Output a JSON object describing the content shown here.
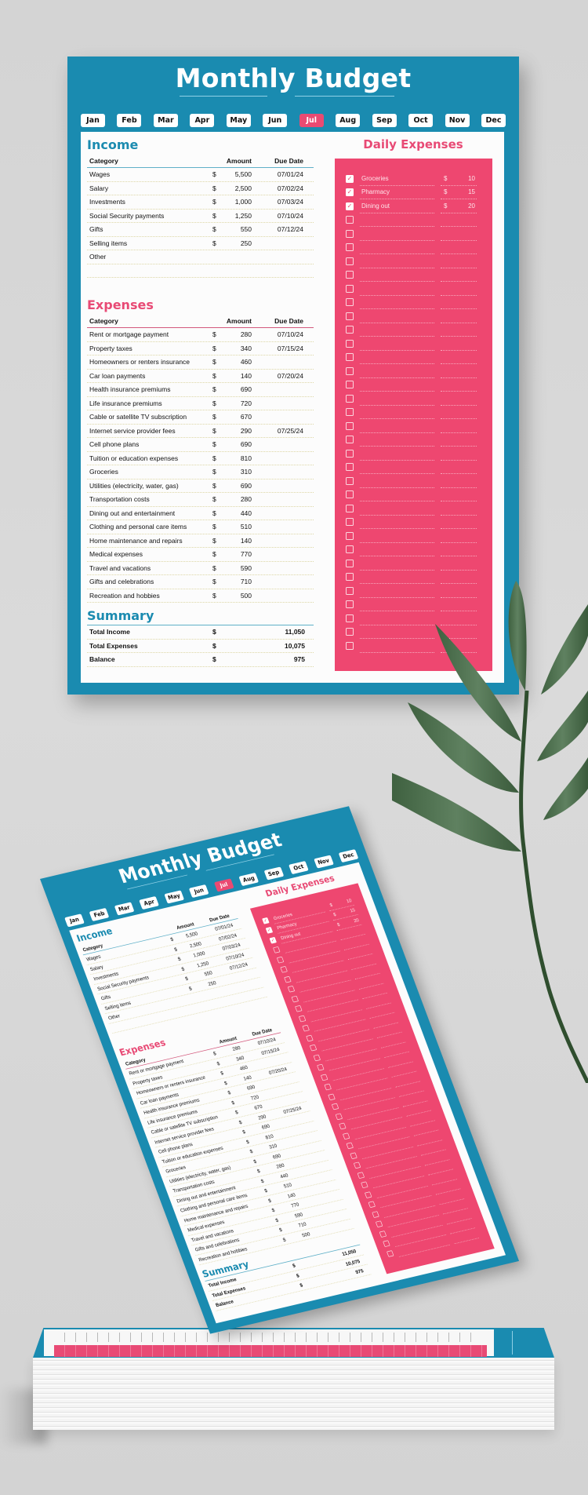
{
  "title": "Monthly Budget",
  "months": [
    {
      "label": "Jan",
      "active": false
    },
    {
      "label": "Feb",
      "active": false
    },
    {
      "label": "Mar",
      "active": false
    },
    {
      "label": "Apr",
      "active": false
    },
    {
      "label": "May",
      "active": false
    },
    {
      "label": "Jun",
      "active": false
    },
    {
      "label": "Jul",
      "active": true
    },
    {
      "label": "Aug",
      "active": false
    },
    {
      "label": "Sep",
      "active": false
    },
    {
      "label": "Oct",
      "active": false
    },
    {
      "label": "Nov",
      "active": false
    },
    {
      "label": "Dec",
      "active": false
    }
  ],
  "colors": {
    "frame": "#1a8bb0",
    "accent_pink": "#ee4770",
    "income_blue": "#1b8bb0",
    "expenses_pink": "#e84a75",
    "background": "#d6d6d6"
  },
  "income": {
    "title": "Income",
    "headers": {
      "category": "Category",
      "amount": "Amount",
      "due_date": "Due Date"
    },
    "rows": [
      {
        "category": "Wages",
        "currency": "$",
        "amount": "5,500",
        "due_date": "07/01/24"
      },
      {
        "category": "Salary",
        "currency": "$",
        "amount": "2,500",
        "due_date": "07/02/24"
      },
      {
        "category": "Investments",
        "currency": "$",
        "amount": "1,000",
        "due_date": "07/03/24"
      },
      {
        "category": "Social Security payments",
        "currency": "$",
        "amount": "1,250",
        "due_date": "07/10/24"
      },
      {
        "category": "Gifts",
        "currency": "$",
        "amount": "550",
        "due_date": "07/12/24"
      },
      {
        "category": "Selling items",
        "currency": "$",
        "amount": "250",
        "due_date": ""
      },
      {
        "category": "Other",
        "currency": "",
        "amount": "",
        "due_date": ""
      },
      {
        "category": "",
        "currency": "",
        "amount": "",
        "due_date": ""
      }
    ]
  },
  "expenses": {
    "title": "Expenses",
    "headers": {
      "category": "Category",
      "amount": "Amount",
      "due_date": "Due Date"
    },
    "rows": [
      {
        "category": "Rent or mortgage payment",
        "currency": "$",
        "amount": "280",
        "due_date": "07/10/24"
      },
      {
        "category": "Property taxes",
        "currency": "$",
        "amount": "340",
        "due_date": "07/15/24"
      },
      {
        "category": "Homeowners or renters insurance",
        "currency": "$",
        "amount": "460",
        "due_date": ""
      },
      {
        "category": "Car loan payments",
        "currency": "$",
        "amount": "140",
        "due_date": "07/20/24"
      },
      {
        "category": "Health insurance premiums",
        "currency": "$",
        "amount": "690",
        "due_date": ""
      },
      {
        "category": "Life insurance premiums",
        "currency": "$",
        "amount": "720",
        "due_date": ""
      },
      {
        "category": "Cable or satellite TV subscription",
        "currency": "$",
        "amount": "670",
        "due_date": ""
      },
      {
        "category": "Internet service provider fees",
        "currency": "$",
        "amount": "290",
        "due_date": "07/25/24"
      },
      {
        "category": "Cell phone plans",
        "currency": "$",
        "amount": "690",
        "due_date": ""
      },
      {
        "category": "Tuition or education expenses",
        "currency": "$",
        "amount": "810",
        "due_date": ""
      },
      {
        "category": "Groceries",
        "currency": "$",
        "amount": "310",
        "due_date": ""
      },
      {
        "category": "Utilities (electricity, water, gas)",
        "currency": "$",
        "amount": "690",
        "due_date": ""
      },
      {
        "category": "Transportation costs",
        "currency": "$",
        "amount": "280",
        "due_date": ""
      },
      {
        "category": "Dining out and entertainment",
        "currency": "$",
        "amount": "440",
        "due_date": ""
      },
      {
        "category": "Clothing and personal care items",
        "currency": "$",
        "amount": "510",
        "due_date": ""
      },
      {
        "category": "Home maintenance and repairs",
        "currency": "$",
        "amount": "140",
        "due_date": ""
      },
      {
        "category": "Medical expenses",
        "currency": "$",
        "amount": "770",
        "due_date": ""
      },
      {
        "category": "Travel and vacations",
        "currency": "$",
        "amount": "590",
        "due_date": ""
      },
      {
        "category": "Gifts and celebrations",
        "currency": "$",
        "amount": "710",
        "due_date": ""
      },
      {
        "category": "Recreation and hobbies",
        "currency": "$",
        "amount": "500",
        "due_date": ""
      }
    ]
  },
  "summary": {
    "title": "Summary",
    "rows": [
      {
        "label": "Total Income",
        "currency": "$",
        "amount": "11,050"
      },
      {
        "label": "Total Expenses",
        "currency": "$",
        "amount": "10,075"
      },
      {
        "label": "Balance",
        "currency": "$",
        "amount": "975"
      }
    ]
  },
  "daily_expenses": {
    "title": "Daily Expenses",
    "checkmark_glyph": "✓",
    "rows": [
      {
        "checked": true,
        "item": "Groceries",
        "currency": "$",
        "amount": "10"
      },
      {
        "checked": true,
        "item": "Pharmacy",
        "currency": "$",
        "amount": "15"
      },
      {
        "checked": true,
        "item": "Dining out",
        "currency": "$",
        "amount": "20"
      },
      {
        "checked": false,
        "item": "",
        "currency": "",
        "amount": ""
      },
      {
        "checked": false,
        "item": "",
        "currency": "",
        "amount": ""
      },
      {
        "checked": false,
        "item": "",
        "currency": "",
        "amount": ""
      },
      {
        "checked": false,
        "item": "",
        "currency": "",
        "amount": ""
      },
      {
        "checked": false,
        "item": "",
        "currency": "",
        "amount": ""
      },
      {
        "checked": false,
        "item": "",
        "currency": "",
        "amount": ""
      },
      {
        "checked": false,
        "item": "",
        "currency": "",
        "amount": ""
      },
      {
        "checked": false,
        "item": "",
        "currency": "",
        "amount": ""
      },
      {
        "checked": false,
        "item": "",
        "currency": "",
        "amount": ""
      },
      {
        "checked": false,
        "item": "",
        "currency": "",
        "amount": ""
      },
      {
        "checked": false,
        "item": "",
        "currency": "",
        "amount": ""
      },
      {
        "checked": false,
        "item": "",
        "currency": "",
        "amount": ""
      },
      {
        "checked": false,
        "item": "",
        "currency": "",
        "amount": ""
      },
      {
        "checked": false,
        "item": "",
        "currency": "",
        "amount": ""
      },
      {
        "checked": false,
        "item": "",
        "currency": "",
        "amount": ""
      },
      {
        "checked": false,
        "item": "",
        "currency": "",
        "amount": ""
      },
      {
        "checked": false,
        "item": "",
        "currency": "",
        "amount": ""
      },
      {
        "checked": false,
        "item": "",
        "currency": "",
        "amount": ""
      },
      {
        "checked": false,
        "item": "",
        "currency": "",
        "amount": ""
      },
      {
        "checked": false,
        "item": "",
        "currency": "",
        "amount": ""
      },
      {
        "checked": false,
        "item": "",
        "currency": "",
        "amount": ""
      },
      {
        "checked": false,
        "item": "",
        "currency": "",
        "amount": ""
      },
      {
        "checked": false,
        "item": "",
        "currency": "",
        "amount": ""
      },
      {
        "checked": false,
        "item": "",
        "currency": "",
        "amount": ""
      },
      {
        "checked": false,
        "item": "",
        "currency": "",
        "amount": ""
      },
      {
        "checked": false,
        "item": "",
        "currency": "",
        "amount": ""
      },
      {
        "checked": false,
        "item": "",
        "currency": "",
        "amount": ""
      },
      {
        "checked": false,
        "item": "",
        "currency": "",
        "amount": ""
      },
      {
        "checked": false,
        "item": "",
        "currency": "",
        "amount": ""
      },
      {
        "checked": false,
        "item": "",
        "currency": "",
        "amount": ""
      },
      {
        "checked": false,
        "item": "",
        "currency": "",
        "amount": ""
      },
      {
        "checked": false,
        "item": "",
        "currency": "",
        "amount": ""
      }
    ]
  }
}
